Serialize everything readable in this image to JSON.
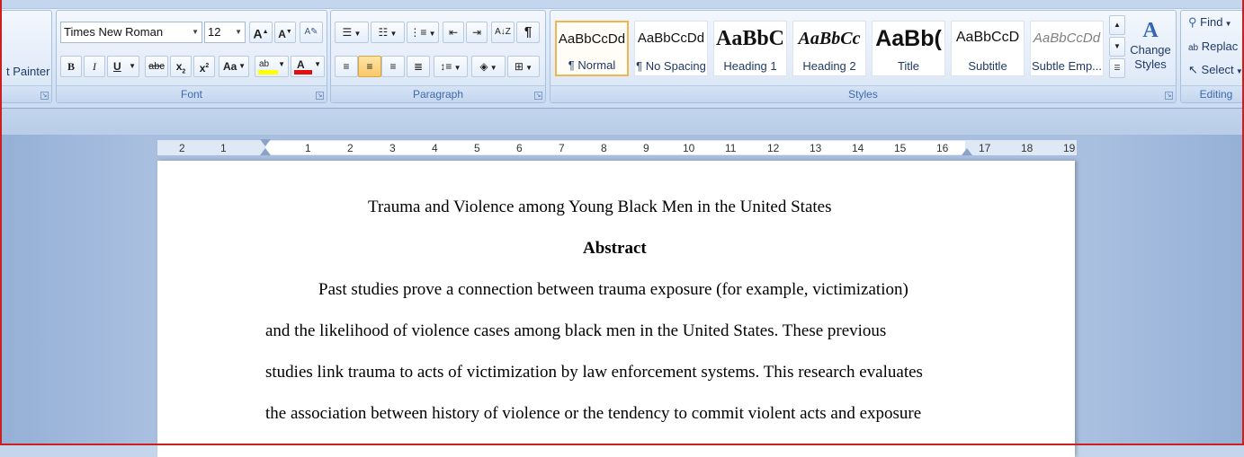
{
  "clipboard": {
    "format_painter": "t Painter"
  },
  "font": {
    "name": "Times New Roman",
    "size": "12",
    "group_label": "Font",
    "bold": "B",
    "italic": "I",
    "underline": "U",
    "strikethrough": "abc",
    "subscript": "x",
    "superscript": "x",
    "change_case": "Aa",
    "grow": "A",
    "shrink": "A",
    "highlight": "ab",
    "font_color": "A",
    "colors": {
      "highlight": "#ffff00",
      "font": "#e01010"
    }
  },
  "paragraph": {
    "group_label": "Paragraph",
    "show_marks": "¶"
  },
  "styles": {
    "group_label": "Styles",
    "items": [
      {
        "sample": "AaBbCcDd",
        "name": "¶ Normal",
        "selected": true
      },
      {
        "sample": "AaBbCcDd",
        "name": "¶ No Spacing"
      },
      {
        "sample": "AaBbC",
        "name": "Heading 1"
      },
      {
        "sample": "AaBbCc",
        "name": "Heading 2"
      },
      {
        "sample": "AaBb(",
        "name": "Title"
      },
      {
        "sample": "AaBbCcD",
        "name": "Subtitle"
      },
      {
        "sample": "AaBbCcDd",
        "name": "Subtle Emp..."
      }
    ],
    "change_styles": "Change Styles"
  },
  "editing": {
    "group_label": "Editing",
    "find": "Find",
    "replace": "Replac",
    "select": "Select"
  },
  "ruler": {
    "numbers": [
      "2",
      "1",
      "1",
      "2",
      "3",
      "4",
      "5",
      "6",
      "7",
      "8",
      "9",
      "10",
      "11",
      "12",
      "13",
      "14",
      "15",
      "16",
      "17",
      "18",
      "19"
    ]
  },
  "document": {
    "title": "Trauma and Violence among Young Black Men in the United States",
    "heading": "Abstract",
    "lines": [
      "Past studies prove a connection between trauma exposure (for example, victimization)",
      "and the likelihood of violence cases among black men in the United States. These previous",
      "studies link trauma to acts of victimization by law enforcement systems. This research evaluates",
      "the association between history of violence or the tendency to commit violent acts and exposure"
    ]
  }
}
